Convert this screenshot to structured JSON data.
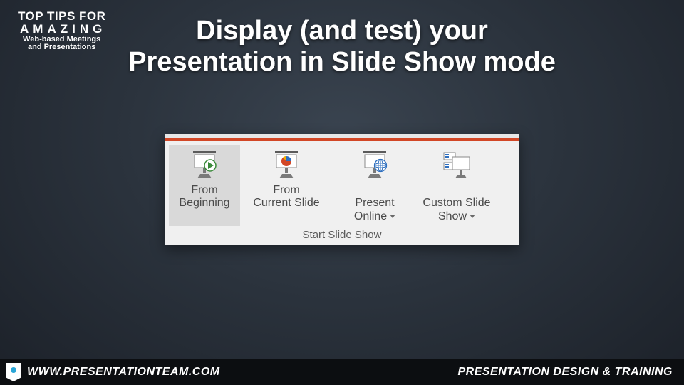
{
  "corner": {
    "line1": "TOP TIPS FOR",
    "line2": "AMAZING",
    "line3": "Web-based Meetings",
    "line4": "and Presentations"
  },
  "title": "Display (and test) your\nPresentation in Slide Show mode",
  "ribbon": {
    "accent_color": "#d24726",
    "group_label": "Start Slide Show",
    "buttons": [
      {
        "id": "from-beginning",
        "label": "From\nBeginning",
        "selected": true,
        "dropdown": false
      },
      {
        "id": "from-current",
        "label": "From\nCurrent Slide",
        "selected": false,
        "dropdown": false
      },
      {
        "id": "present-online",
        "label": "Present\nOnline",
        "selected": false,
        "dropdown": true
      },
      {
        "id": "custom-slide-show",
        "label": "Custom Slide\nShow",
        "selected": false,
        "dropdown": true
      }
    ]
  },
  "footer": {
    "url": "WWW.PRESENTATIONTEAM.COM",
    "tagline": "PRESENTATION DESIGN & TRAINING"
  }
}
